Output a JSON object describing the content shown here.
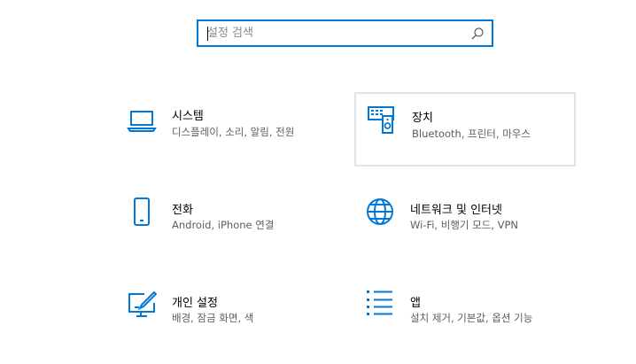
{
  "search": {
    "placeholder": "설정 검색",
    "value": ""
  },
  "colors": {
    "accent": "#0078d7",
    "tile_hover_border": "#e3e3e3",
    "desc_text": "#5d5d5d"
  },
  "tiles": [
    {
      "title": "시스템",
      "desc": "디스플레이, 소리, 알림, 전원",
      "icon": "laptop-icon"
    },
    {
      "title": "장치",
      "desc": "Bluetooth, 프린터, 마우스",
      "icon": "devices-icon"
    },
    {
      "title": "전화",
      "desc": "Android, iPhone 연결",
      "icon": "phone-icon"
    },
    {
      "title": "네트워크 및 인터넷",
      "desc": "Wi-Fi, 비행기 모드, VPN",
      "icon": "globe-icon"
    },
    {
      "title": "개인 설정",
      "desc": "배경, 잠금 화면, 색",
      "icon": "personalization-icon"
    },
    {
      "title": "앱",
      "desc": "설치 제거, 기본값, 옵션 기능",
      "icon": "apps-list-icon"
    }
  ]
}
